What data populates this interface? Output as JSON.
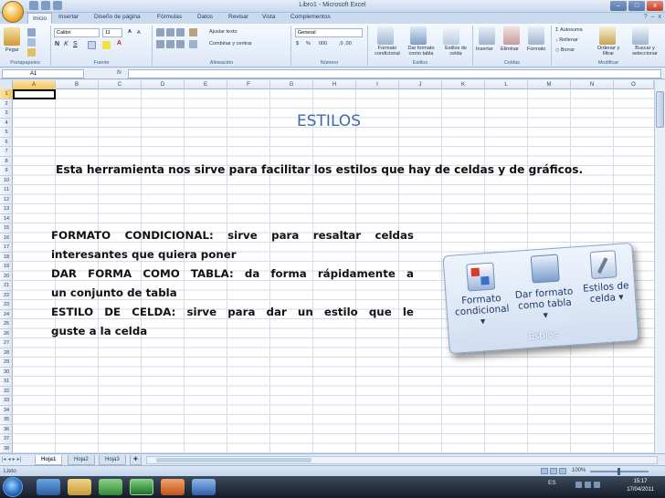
{
  "window": {
    "title": "Libro1 - Microsoft Excel",
    "min": "–",
    "max": "□",
    "close": "x"
  },
  "tabs": [
    "Inicio",
    "Insertar",
    "Diseño de página",
    "Fórmulas",
    "Datos",
    "Revisar",
    "Vista",
    "Complementos"
  ],
  "ribbon": {
    "clipboard": {
      "paste": "Pegar",
      "label": "Portapapeles"
    },
    "font": {
      "name": "Calibri",
      "size": "11",
      "label": "Fuente"
    },
    "alignment": {
      "wrap": "Ajustar texto",
      "merge": "Combinar y centrar",
      "label": "Alineación"
    },
    "number": {
      "format": "General",
      "label": "Número"
    },
    "styles": {
      "conditional": "Formato condicional",
      "table": "Dar formato como tabla",
      "cell": "Estilos de celda",
      "label": "Estilos"
    },
    "cells": {
      "insert": "Insertar",
      "delete": "Eliminar",
      "format": "Formato",
      "label": "Celdas"
    },
    "editing": {
      "autosum": "Autosuma",
      "fill": "Rellenar",
      "clear": "Borrar",
      "sort": "Ordenar y filtrar",
      "find": "Buscar y seleccionar",
      "label": "Modificar"
    }
  },
  "formula_bar": {
    "cell": "A1",
    "fx": "fx"
  },
  "columns": [
    "A",
    "B",
    "C",
    "D",
    "E",
    "F",
    "G",
    "H",
    "I",
    "J",
    "K",
    "L",
    "M",
    "N",
    "O"
  ],
  "rows": [
    "1",
    "2",
    "3",
    "4",
    "5",
    "6",
    "7",
    "8",
    "9",
    "10",
    "11",
    "12",
    "13",
    "14",
    "15",
    "16",
    "17",
    "18",
    "19",
    "20",
    "21",
    "22",
    "23",
    "24",
    "25",
    "26",
    "27",
    "28",
    "29",
    "30",
    "31",
    "32",
    "33",
    "34",
    "35",
    "36",
    "37",
    "38"
  ],
  "slide": {
    "title": "ESTILOS",
    "intro": "Esta herramienta nos sirve para facilitar los estilos que hay de celdas y de gráficos.",
    "lines": [
      "FORMATO CONDICIONAL: sirve para resaltar celdas",
      "interesantes que quiera poner",
      "DAR FORMA COMO TABLA: da forma rápidamente a",
      "un conjunto de tabla",
      "ESTILO DE CELDA: sirve para dar un estilo que le",
      "guste a la celda"
    ],
    "callout": {
      "conditional_1": "Formato",
      "conditional_2": "condicional",
      "table_1": "Dar formato",
      "table_2": "como tabla",
      "cell_1": "Estilos de",
      "cell_2": "celda",
      "group": "Estilos"
    }
  },
  "sheets": [
    "Hoja1",
    "Hoja2",
    "Hoja3"
  ],
  "status": {
    "text": "Listo",
    "zoom": "100%"
  },
  "taskbar": {
    "lang": "ES",
    "time": "15:17",
    "date": "17/04/2011"
  }
}
